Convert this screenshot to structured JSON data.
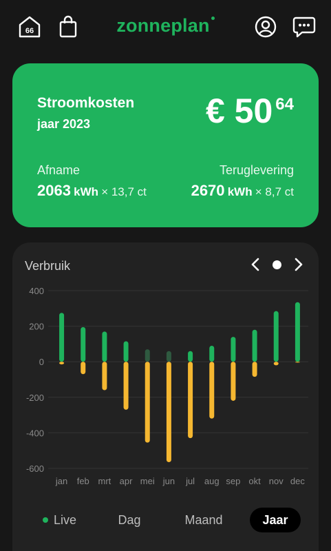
{
  "brand": {
    "logo_text": "zonneplan",
    "accent": "#1fb35d"
  },
  "header_icons": [
    "house-66-icon",
    "shopping-bag-icon",
    "user-circle-icon",
    "chat-bubble-icon"
  ],
  "house_badge": "66",
  "cost_card": {
    "title": "Stroomkosten",
    "period": "jaar 2023",
    "amount_main": "€ 50",
    "amount_cents": "64",
    "afname": {
      "label": "Afname",
      "value": "2063",
      "unit": "kWh",
      "multiplier": "× 13,7 ct"
    },
    "teruglevering": {
      "label": "Teruglevering",
      "value": "2670",
      "unit": "kWh",
      "multiplier": "× 8,7 ct"
    }
  },
  "chart_card": {
    "title": "Verbruik"
  },
  "chart_data": {
    "type": "bar",
    "categories": [
      "jan",
      "feb",
      "mrt",
      "apr",
      "mei",
      "jun",
      "jul",
      "aug",
      "sep",
      "okt",
      "nov",
      "dec"
    ],
    "series": [
      {
        "color": "#1fb35d",
        "values": [
          275,
          195,
          170,
          115,
          70,
          60,
          60,
          90,
          140,
          180,
          285,
          335
        ]
      },
      {
        "color": "#f5b731",
        "values": [
          -15,
          -70,
          -160,
          -270,
          -455,
          -565,
          -430,
          -320,
          -220,
          -85,
          -20,
          -5
        ]
      }
    ],
    "muted_months": [
      "mei",
      "jun"
    ],
    "ylim": [
      -600,
      400
    ],
    "yticks": [
      400,
      200,
      0,
      -200,
      -400,
      -600
    ],
    "grid": true
  },
  "tabs": {
    "live": "Live",
    "dag": "Dag",
    "maand": "Maand",
    "jaar": "Jaar",
    "active": "Jaar"
  }
}
